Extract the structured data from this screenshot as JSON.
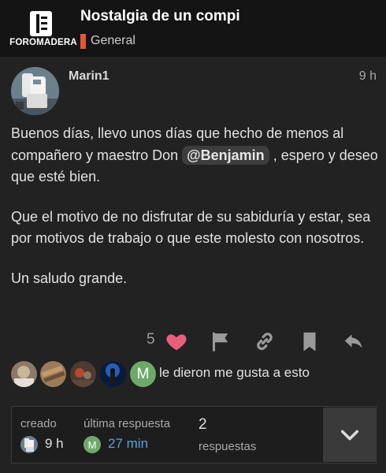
{
  "header": {
    "site_name": "FOROMADERA",
    "topic_title": "Nostalgia de un compi",
    "category": "General",
    "category_color": "#e45735"
  },
  "post": {
    "author": "Marin1",
    "age": "9 h",
    "paragraphs": {
      "p1_before": "Buenos días, llevo unos días que hecho de menos al compañero y maestro Don ",
      "mention": "@Benjamin",
      "p1_after": " , espero y deseo que esté bien.",
      "p2": "Que el motivo de no disfrutar de su sabiduría y estar, sea por motivos de trabajo o que este molesto con nosotros.",
      "p3": "Un saludo grande."
    },
    "like_count": "5",
    "liked_by_text": "le dieron me gusta a esto",
    "liker_letter": "M",
    "icons": [
      "heart-icon",
      "flag-icon",
      "link-icon",
      "bookmark-icon",
      "reply-icon"
    ]
  },
  "footer": {
    "created_label": "creado",
    "created_value": "9 h",
    "last_reply_label": "última respuesta",
    "last_reply_value": "27 min",
    "last_reply_letter": "M",
    "replies_count": "2",
    "replies_label": "respuestas"
  },
  "colors": {
    "background": "#222222",
    "header": "#141414",
    "like": "#e85f7c",
    "link": "#5e9ee0",
    "avatar_green": "#6ea96a"
  }
}
